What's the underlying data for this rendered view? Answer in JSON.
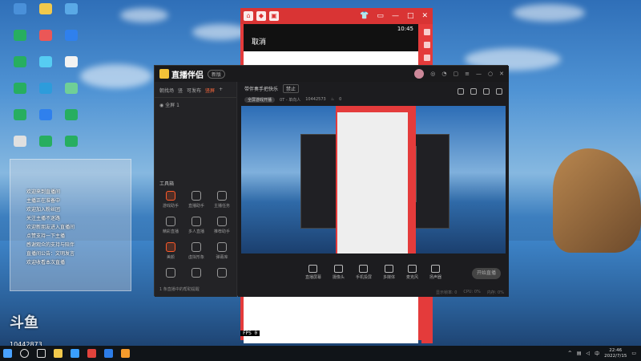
{
  "desktop": {
    "icons": [
      {
        "label": "",
        "color": "#4a90d9"
      },
      {
        "label": "",
        "color": "#f2c94c"
      },
      {
        "label": "",
        "color": "#5aa9e6"
      },
      {
        "label": "",
        "color": "#27ae60"
      },
      {
        "label": "",
        "color": "#eb5757"
      },
      {
        "label": "",
        "color": "#2f80ed"
      },
      {
        "label": "",
        "color": "#27ae60"
      },
      {
        "label": "",
        "color": "#56ccf2"
      },
      {
        "label": "",
        "color": "#f2f2f2"
      },
      {
        "label": "",
        "color": "#27ae60"
      },
      {
        "label": "",
        "color": "#2d9cdb"
      },
      {
        "label": "",
        "color": "#6fcf97"
      },
      {
        "label": "",
        "color": "#27ae60"
      },
      {
        "label": "",
        "color": "#2f80ed"
      },
      {
        "label": "",
        "color": "#27ae60"
      },
      {
        "label": "",
        "color": "#e0e0e0"
      },
      {
        "label": "",
        "color": "#27ae60"
      },
      {
        "label": "",
        "color": "#27ae60"
      }
    ]
  },
  "phone": {
    "status_time": "10:45",
    "title": "取消",
    "fps": "FPS  0"
  },
  "app": {
    "name": "直播伴侣",
    "version": "新版",
    "scene_tabs": [
      "朝找场",
      "竖",
      "可发布",
      "竖屏"
    ],
    "scene_add": "+",
    "scene_item": "全屏 1",
    "tools_title": "工具箱",
    "tools": [
      {
        "label": "游戏助手",
        "hot": true
      },
      {
        "label": "直播助手",
        "hot": false
      },
      {
        "label": "主播任务",
        "hot": false
      },
      {
        "label": "精彩直播",
        "hot": false
      },
      {
        "label": "多人直播",
        "hot": false
      },
      {
        "label": "推荐助手",
        "hot": false
      },
      {
        "label": "美颜",
        "hot": true
      },
      {
        "label": "虚拟形象",
        "hot": false
      },
      {
        "label": "弹幕库",
        "hot": false
      },
      {
        "label": "",
        "hot": false
      },
      {
        "label": "",
        "hot": false
      },
      {
        "label": "",
        "hot": false
      }
    ],
    "bottom_hint": "1 条直播中的帮助提醒",
    "room_title": "带伴奏手把快乐",
    "room_tag": "禁止",
    "room_category": "全屏游戏开播",
    "room_meta": "0T - 单向人",
    "room_id": "10442573",
    "room_likes": "0",
    "controls": [
      "直播屏幕",
      "摄像头",
      "手机投屏",
      "多媒体",
      "麦克风",
      "扬声器"
    ],
    "go_live": "开始直播",
    "status": [
      "显示帧率: 0",
      "CPU: 0%",
      "内存: 0%"
    ]
  },
  "chat": {
    "lines": [
      "欢迎来到直播间",
      "主播正在准备中",
      "欢迎加入粉丝团",
      "关注主播不迷路",
      "欢迎新朋友进入直播间",
      "点赞支持一下主播",
      "感谢观众的支持与陪伴",
      "直播间公告：文明发言",
      "欢迎收看本次直播"
    ]
  },
  "watermark": {
    "brand": "斗鱼",
    "room_id": "10442873"
  },
  "taskbar": {
    "time": "22:46",
    "date": "2022/7/15",
    "lang": "中"
  }
}
